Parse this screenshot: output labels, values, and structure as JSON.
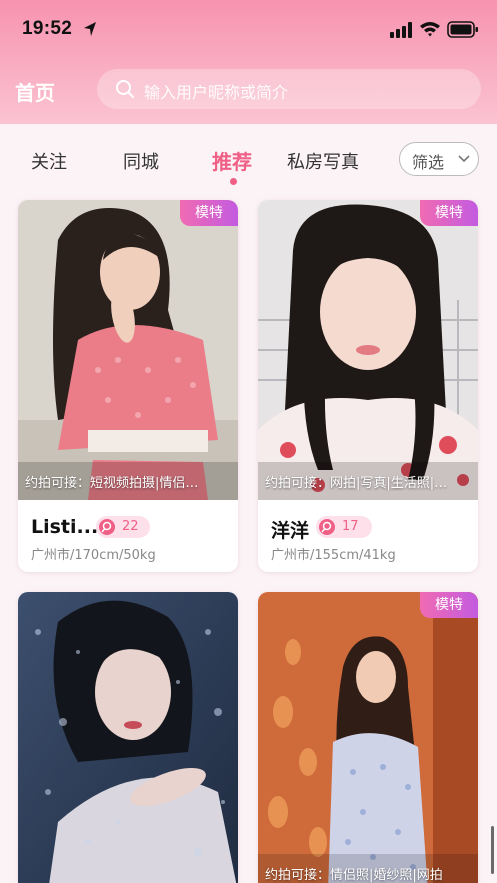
{
  "status_bar": {
    "time": "19:52"
  },
  "header": {
    "title": "首页",
    "search_placeholder": "输入用户昵称或简介"
  },
  "tabs": [
    "关注",
    "同城",
    "推荐",
    "私房写真"
  ],
  "active_tab": "推荐",
  "filter_label": "筛选",
  "cards": [
    {
      "badge": "模特",
      "caption": "约拍可接：短视频拍摄|情侣…",
      "name": "Listi...",
      "age": "22",
      "meta": "广州市/170cm/50kg"
    },
    {
      "badge": "模特",
      "caption": "约拍可接：网拍|写真|生活照|…",
      "name": "洋洋",
      "age": "17",
      "meta": "广州市/155cm/41kg"
    },
    {
      "badge": "",
      "caption": "",
      "name": "",
      "age": "",
      "meta": ""
    },
    {
      "badge": "模特",
      "caption": "约拍可接：情侣照|婚纱照|网拍",
      "name": "",
      "age": "",
      "meta": ""
    }
  ],
  "colors": {
    "accent": "#ef5f86",
    "header_top": "#f793b0",
    "badge_from": "#f06bb2",
    "badge_to": "#c35be0"
  },
  "icons": [
    "location-arrow-icon",
    "signal-icon",
    "wifi-icon",
    "battery-icon",
    "search-icon",
    "chevron-down-icon",
    "female-icon"
  ]
}
